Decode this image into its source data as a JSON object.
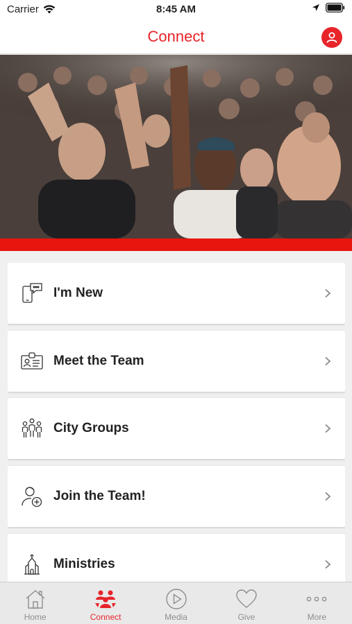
{
  "status_bar": {
    "carrier": "Carrier",
    "time": "8:45 AM"
  },
  "nav": {
    "title": "Connect",
    "profile_icon": "person-icon"
  },
  "accent_color": "#e8232a",
  "items": [
    {
      "label": "I'm New",
      "icon": "phone-chat-icon"
    },
    {
      "label": "Meet the Team",
      "icon": "id-card-icon"
    },
    {
      "label": "City Groups",
      "icon": "group-people-icon"
    },
    {
      "label": "Join the Team!",
      "icon": "person-add-icon"
    },
    {
      "label": "Ministries",
      "icon": "church-icon"
    }
  ],
  "tabs": [
    {
      "label": "Home",
      "icon": "home-icon",
      "active": false
    },
    {
      "label": "Connect",
      "icon": "people-icon",
      "active": true
    },
    {
      "label": "Media",
      "icon": "play-icon",
      "active": false
    },
    {
      "label": "Give",
      "icon": "heart-icon",
      "active": false
    },
    {
      "label": "More",
      "icon": "more-dots-icon",
      "active": false
    }
  ]
}
